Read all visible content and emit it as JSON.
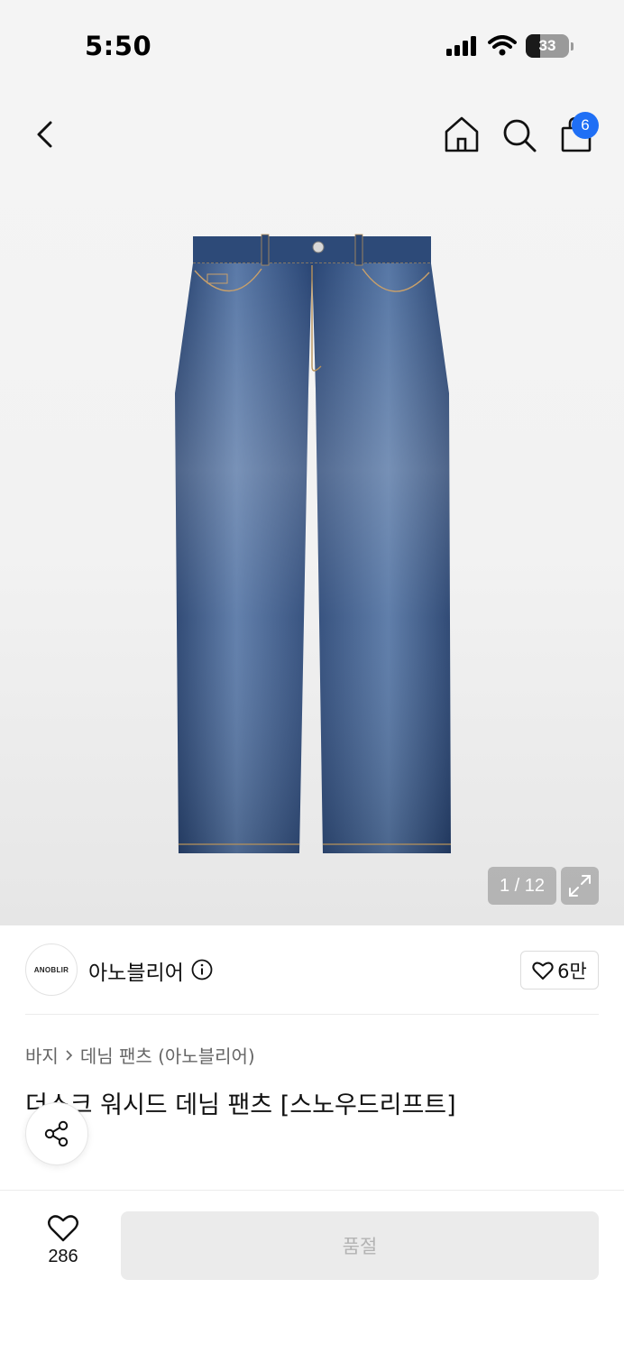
{
  "status_bar": {
    "time": "5:50",
    "battery": "33"
  },
  "header": {
    "cart_count": "6"
  },
  "gallery": {
    "counter": "1 / 12"
  },
  "brand": {
    "logo_text": "ANOBLIR",
    "name": "아노블리어",
    "like_count": "6만"
  },
  "breadcrumb": {
    "category": "바지",
    "subcategory": "데님 팬츠 (아노블리어)"
  },
  "product": {
    "title": "더스크 워시드 데님 팬츠 [스노우드리프트]"
  },
  "bottom": {
    "wish_count": "286",
    "buy_label": "품절"
  },
  "colors": {
    "accent": "#1f6ff5",
    "denim": "#2f4f7f",
    "disabled": "#ebebeb"
  }
}
